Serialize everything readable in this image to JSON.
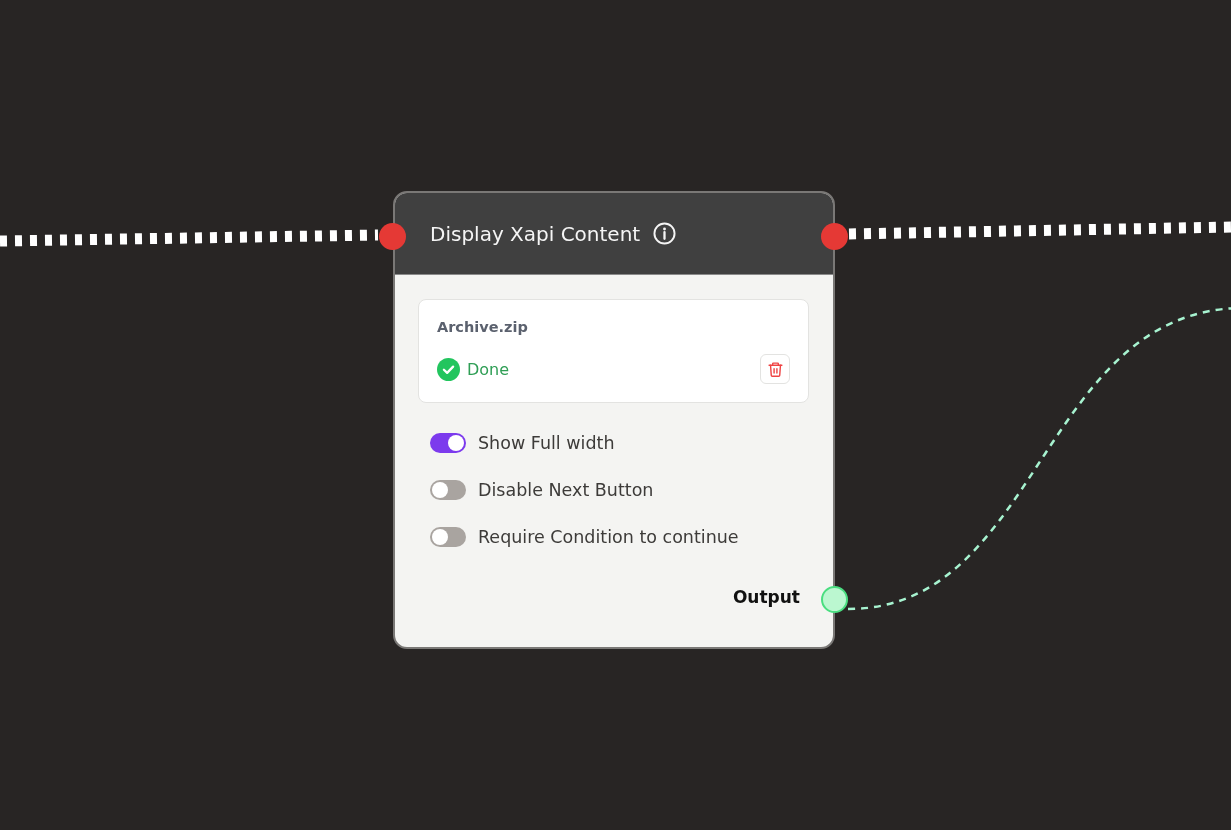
{
  "node": {
    "title": "Display Xapi Content",
    "file": {
      "name": "Archive.zip",
      "status": "Done"
    },
    "options": [
      {
        "label": "Show Full width",
        "on": true
      },
      {
        "label": "Disable Next Button",
        "on": false
      },
      {
        "label": "Require Condition to continue",
        "on": false
      }
    ],
    "output": {
      "label": "Output"
    }
  }
}
